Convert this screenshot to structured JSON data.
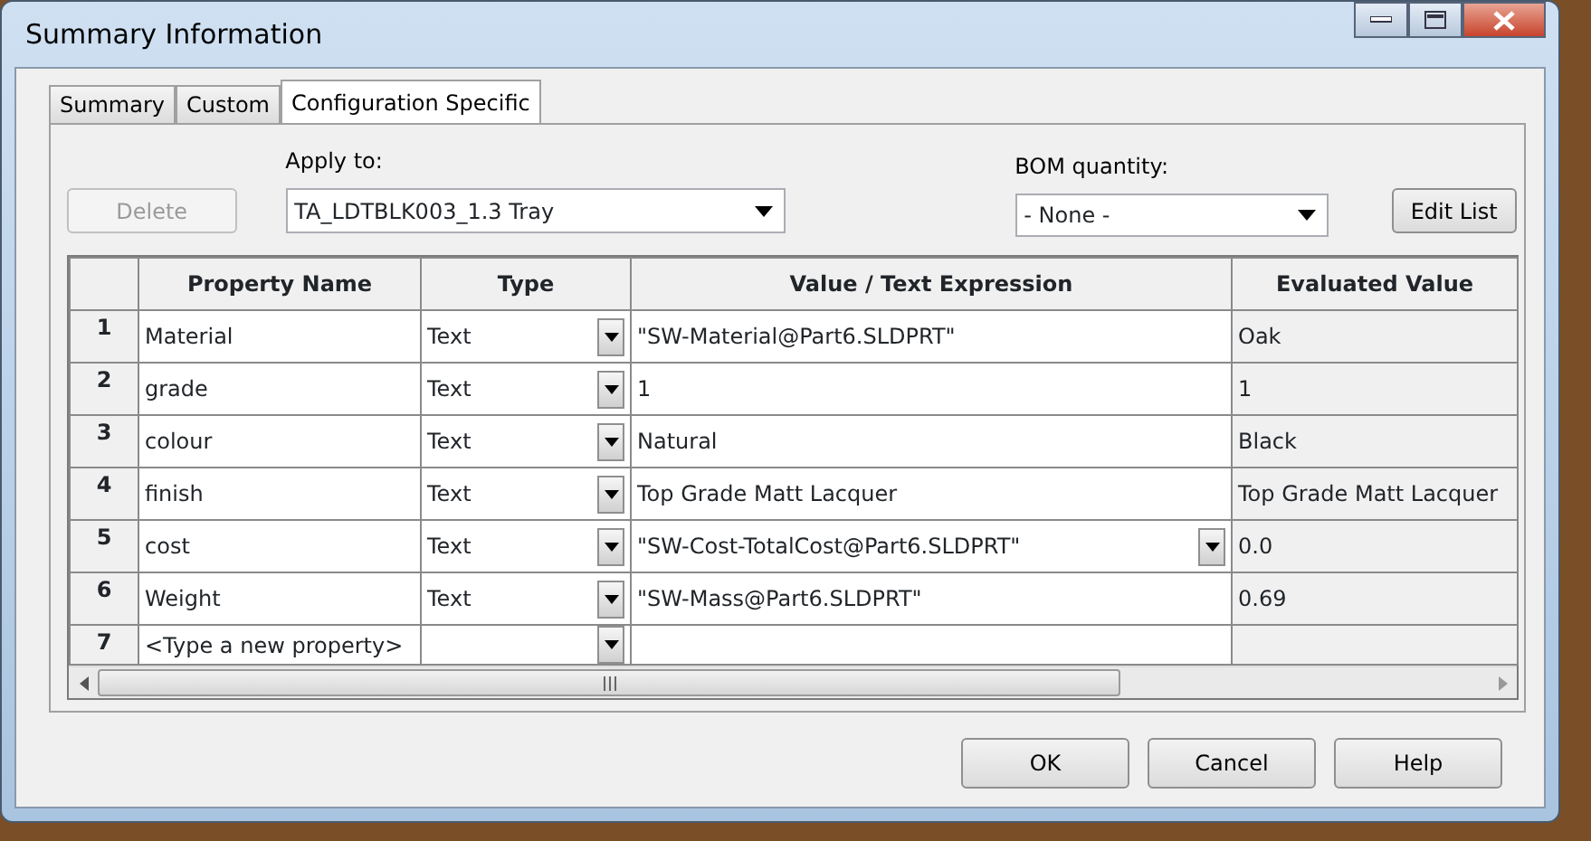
{
  "window": {
    "title": "Summary Information"
  },
  "tabs": [
    {
      "label": "Summary",
      "selected": false
    },
    {
      "label": "Custom",
      "selected": false
    },
    {
      "label": "Configuration Specific",
      "selected": true
    }
  ],
  "toolbar": {
    "delete_button": {
      "label": "Delete",
      "disabled": true
    },
    "apply_to": {
      "label": "Apply to:",
      "value": "TA_LDTBLK003_1.3 Tray"
    },
    "bom_quantity": {
      "label": "BOM quantity:",
      "value": "- None -"
    },
    "edit_list_button": {
      "label": "Edit List",
      "disabled": false
    }
  },
  "table": {
    "columns": [
      "Property Name",
      "Type",
      "Value / Text Expression",
      "Evaluated Value"
    ],
    "rows": [
      {
        "number": "1",
        "property": "Material",
        "type": "Text",
        "value": "\"SW-Material@Part6.SLDPRT\"",
        "evaluated": "Oak",
        "editing": false
      },
      {
        "number": "2",
        "property": "grade",
        "type": "Text",
        "value": "1",
        "evaluated": "1",
        "editing": false
      },
      {
        "number": "3",
        "property": "colour",
        "type": "Text",
        "value": "Natural",
        "evaluated": "Black",
        "editing": false
      },
      {
        "number": "4",
        "property": "finish",
        "type": "Text",
        "value": "Top Grade Matt Lacquer",
        "evaluated": "Top Grade Matt Lacquer",
        "editing": false
      },
      {
        "number": "5",
        "property": "cost",
        "type": "Text",
        "value": "\"SW-Cost-TotalCost@Part6.SLDPRT\"",
        "evaluated": "0.0",
        "editing": true
      },
      {
        "number": "6",
        "property": "Weight",
        "type": "Text",
        "value": "\"SW-Mass@Part6.SLDPRT\"",
        "evaluated": "0.69",
        "editing": false
      },
      {
        "number": "7",
        "property": "<Type a new property>",
        "type": "",
        "value": "",
        "evaluated": "",
        "editing": false
      }
    ]
  },
  "buttons": [
    {
      "label": "OK"
    },
    {
      "label": "Cancel"
    },
    {
      "label": "Help"
    }
  ]
}
